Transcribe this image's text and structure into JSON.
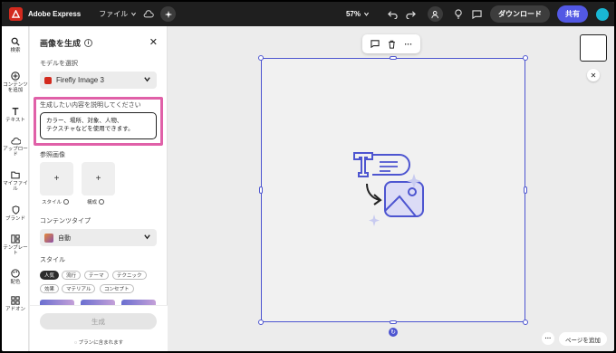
{
  "topbar": {
    "app_name": "Adobe Express",
    "file_menu": "ファイル",
    "zoom": "57%",
    "download_label": "ダウンロード",
    "share_label": "共有"
  },
  "rail": [
    {
      "label": "検索",
      "icon": "search-icon"
    },
    {
      "label": "コンテンツを追加",
      "icon": "plus-circle-icon"
    },
    {
      "label": "テキスト",
      "icon": "text-icon"
    },
    {
      "label": "アップロード",
      "icon": "upload-icon"
    },
    {
      "label": "マイファイル",
      "icon": "folder-icon"
    },
    {
      "label": "ブランド",
      "icon": "brand-icon"
    },
    {
      "label": "テンプレート",
      "icon": "template-icon"
    },
    {
      "label": "配色",
      "icon": "palette-icon"
    },
    {
      "label": "アドオン",
      "icon": "addon-icon"
    }
  ],
  "panel": {
    "title": "画像を生成",
    "model_label": "モデルを選択",
    "model_value": "Firefly Image 3",
    "prompt_label": "生成したい内容を説明してください",
    "prompt_placeholder_line1": "カラー、場所、対象、人物、",
    "prompt_placeholder_line2": "テクスチャなどを使用できます。",
    "reference_label": "参照画像",
    "ref_style": "スタイル",
    "ref_composition": "構成",
    "content_type_label": "コンテンツタイプ",
    "content_type_value": "自動",
    "style_label": "スタイル",
    "chips": [
      "人気",
      "流行",
      "テーマ",
      "テクニック",
      "効果",
      "マテリアル",
      "コンセプト"
    ],
    "generate_label": "生成",
    "plan_note": "プランに含まれます"
  },
  "canvas": {
    "add_page_label": "ページを追加"
  },
  "colors": {
    "accent": "#5258e4",
    "highlight": "#e060a8",
    "selection": "#4d55d0"
  }
}
